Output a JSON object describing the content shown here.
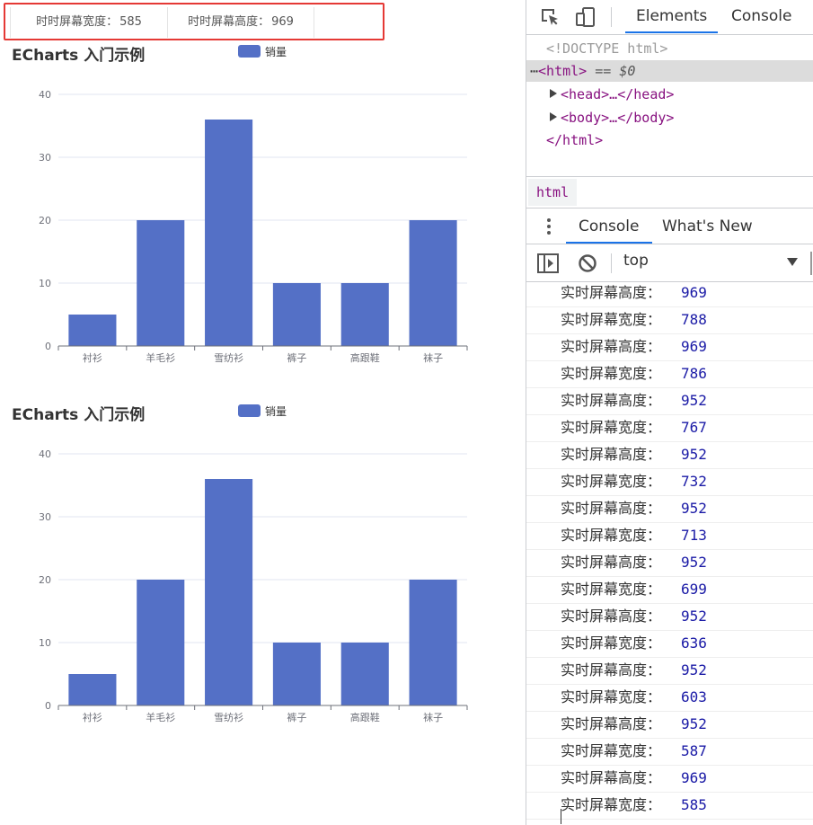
{
  "infobar": {
    "width_label": "时时屏幕宽度：",
    "width_value": "585",
    "height_label": "时时屏幕高度：",
    "height_value": "969"
  },
  "charts": [
    {
      "title": "ECharts 入门示例",
      "legend": "销量"
    },
    {
      "title": "ECharts 入门示例",
      "legend": "销量"
    }
  ],
  "chart_data": [
    {
      "type": "bar",
      "title": "ECharts 入门示例",
      "categories": [
        "衬衫",
        "羊毛衫",
        "雪纺衫",
        "裤子",
        "高跟鞋",
        "袜子"
      ],
      "series": [
        {
          "name": "销量",
          "values": [
            5,
            20,
            36,
            10,
            10,
            20
          ]
        }
      ],
      "yticks": [
        0,
        10,
        20,
        30,
        40
      ],
      "ylim": [
        0,
        40
      ],
      "grid": true,
      "legend_position": "top-center",
      "color": "#5470c6"
    },
    {
      "type": "bar",
      "title": "ECharts 入门示例",
      "categories": [
        "衬衫",
        "羊毛衫",
        "雪纺衫",
        "裤子",
        "高跟鞋",
        "袜子"
      ],
      "series": [
        {
          "name": "销量",
          "values": [
            5,
            20,
            36,
            10,
            10,
            20
          ]
        }
      ],
      "yticks": [
        0,
        10,
        20,
        30,
        40
      ],
      "ylim": [
        0,
        40
      ],
      "grid": true,
      "legend_position": "top-center",
      "color": "#5470c6"
    }
  ],
  "devtools": {
    "tabs": {
      "elements": "Elements",
      "console": "Console"
    },
    "icons": {
      "inspect": "inspect-element-icon",
      "device": "device-toolbar-icon"
    },
    "tree": {
      "doctype": "<!DOCTYPE html>",
      "html_open": "<html>",
      "html_suffix": " == $0",
      "head": "<head>…</head>",
      "body": "<body>…</body>",
      "html_close": "</html>"
    },
    "breadcrumb": "html",
    "drawer_tabs": {
      "console": "Console",
      "whats_new": "What's New"
    },
    "toolbar": {
      "context": "top"
    },
    "logs": [
      {
        "label": "实时屏幕高度：",
        "value": "969"
      },
      {
        "label": "实时屏幕宽度：",
        "value": "788"
      },
      {
        "label": "实时屏幕高度：",
        "value": "969"
      },
      {
        "label": "实时屏幕宽度：",
        "value": "786"
      },
      {
        "label": "实时屏幕高度：",
        "value": "952"
      },
      {
        "label": "实时屏幕宽度：",
        "value": "767"
      },
      {
        "label": "实时屏幕高度：",
        "value": "952"
      },
      {
        "label": "实时屏幕宽度：",
        "value": "732"
      },
      {
        "label": "实时屏幕高度：",
        "value": "952"
      },
      {
        "label": "实时屏幕宽度：",
        "value": "713"
      },
      {
        "label": "实时屏幕高度：",
        "value": "952"
      },
      {
        "label": "实时屏幕宽度：",
        "value": "699"
      },
      {
        "label": "实时屏幕高度：",
        "value": "952"
      },
      {
        "label": "实时屏幕宽度：",
        "value": "636"
      },
      {
        "label": "实时屏幕高度：",
        "value": "952"
      },
      {
        "label": "实时屏幕宽度：",
        "value": "603"
      },
      {
        "label": "实时屏幕高度：",
        "value": "952"
      },
      {
        "label": "实时屏幕宽度：",
        "value": "587"
      },
      {
        "label": "实时屏幕高度：",
        "value": "969"
      },
      {
        "label": "实时屏幕宽度：",
        "value": "585"
      }
    ]
  },
  "colors": {
    "accent": "#1a73e8",
    "bar": "#5470c6",
    "highlight_border": "#e53935",
    "tag": "#881280",
    "console_number": "#1a1aa6"
  }
}
